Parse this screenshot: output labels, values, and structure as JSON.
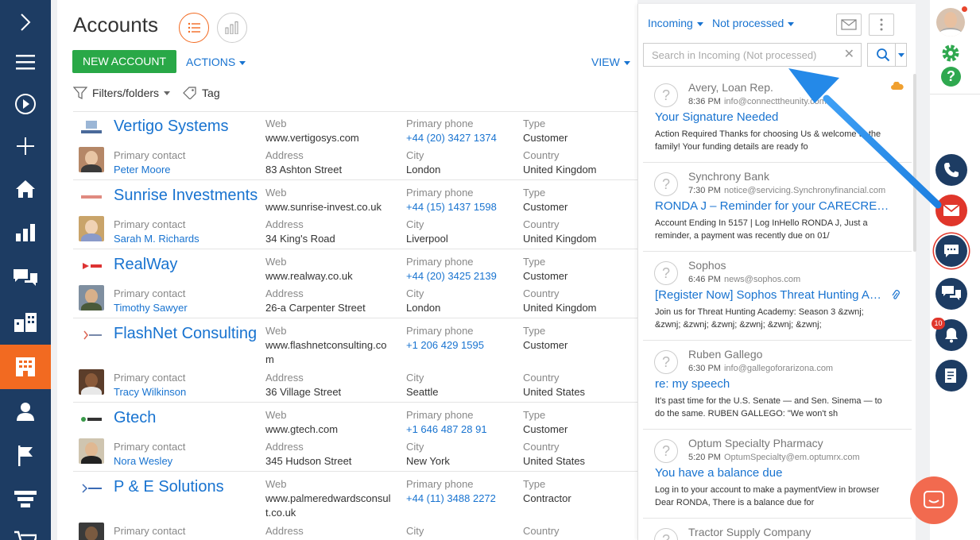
{
  "page": {
    "title": "Accounts",
    "new_account_label": "NEW ACCOUNT",
    "actions_label": "ACTIONS",
    "view_label": "VIEW",
    "filters_label": "Filters/folders",
    "tag_label": "Tag"
  },
  "nav": {
    "items": [
      "chevron-right-icon",
      "menu-icon",
      "play-icon",
      "plus-icon",
      "home-icon",
      "chart-icon",
      "chat-icon",
      "buildings-icon",
      "accounts-icon",
      "contact-icon",
      "flag-icon",
      "funnel-icon",
      "cart-icon"
    ],
    "active": "accounts-icon"
  },
  "labels": {
    "web": "Web",
    "primary_phone": "Primary phone",
    "type": "Type",
    "primary_contact": "Primary contact",
    "address": "Address",
    "city": "City",
    "country": "Country"
  },
  "accounts": [
    {
      "name": "Vertigo Systems",
      "web": "www.vertigosys.com",
      "phone": "+44 (20) 3427 1374",
      "type": "Customer",
      "contact": "Peter Moore",
      "address": "83 Ashton Street",
      "city": "London",
      "country": "United Kingdom"
    },
    {
      "name": "Sunrise Investments",
      "web": "www.sunrise-invest.co.uk",
      "phone": "+44 (15) 1437 1598",
      "type": "Customer",
      "contact": "Sarah M. Richards",
      "address": "34 King's Road",
      "city": "Liverpool",
      "country": "United Kingdom"
    },
    {
      "name": "RealWay",
      "web": "www.realway.co.uk",
      "phone": "+44 (20) 3425 2139",
      "type": "Customer",
      "contact": "Timothy Sawyer",
      "address": "26-a Carpenter Street",
      "city": "London",
      "country": "United Kingdom"
    },
    {
      "name": "FlashNet Consulting",
      "web": "www.flashnetconsulting.com",
      "phone": "+1 206 429 1595",
      "type": "Customer",
      "contact": "Tracy Wilkinson",
      "address": "36 Village Street",
      "city": "Seattle",
      "country": "United States"
    },
    {
      "name": "Gtech",
      "web": "www.gtech.com",
      "phone": "+1 646 487 28 91",
      "type": "Customer",
      "contact": "Nora Wesley",
      "address": "345 Hudson Street",
      "city": "New York",
      "country": "United States"
    },
    {
      "name": "P & E Solutions",
      "web": "www.palmeredwardsconsult.co.uk",
      "phone": "+44 (11) 3488 2272",
      "type": "Contractor",
      "contact": "",
      "address": "",
      "city": "",
      "country": ""
    }
  ],
  "feed": {
    "folder_label": "Incoming",
    "status_label": "Not processed",
    "search_placeholder": "Search in Incoming (Not processed)",
    "emails": [
      {
        "sender": "Avery, Loan Rep.",
        "time": "8:36 PM",
        "from": "info@connecttheunity.com",
        "subject": "Your Signature Needed",
        "preview": "Action Required Thanks for choosing Us & welcome to the family! Your funding details are ready fo"
      },
      {
        "sender": "Synchrony Bank",
        "time": "7:30 PM",
        "from": "notice@servicing.Synchronyfinancial.com",
        "subject": "RONDA J – Reminder for your CARECREDIT/S...",
        "preview": "Account Ending In 5157 | Log InHello RONDA J, Just a reminder, a payment was recently due on 01/"
      },
      {
        "sender": "Sophos",
        "time": "6:46 PM",
        "from": "news@sophos.com",
        "subject": "[Register Now] Sophos Threat Hunting Acad...",
        "preview": "Join us for Threat Hunting Academy: Season 3 &zwnj; &zwnj; &zwnj; &zwnj; &zwnj; &zwnj; &zwnj;"
      },
      {
        "sender": "Ruben Gallego",
        "time": "6:30 PM",
        "from": "info@gallegoforarizona.com",
        "subject": "re: my speech",
        "preview": "It's past time for the U.S. Senate — and Sen. Sinema — to do the same. RUBEN GALLEGO: \"We won't sh"
      },
      {
        "sender": "Optum Specialty Pharmacy",
        "time": "5:20 PM",
        "from": "OptumSpecialty@em.optumrx.com",
        "subject": "You have a balance due",
        "preview": "Log in to your account to make a paymentView in browser Dear RONDA, There is a balance due for"
      },
      {
        "sender": "Tractor Supply Company",
        "time": "",
        "from": "",
        "subject": "",
        "preview": ""
      }
    ]
  },
  "right_bar": {
    "notification_count": "10"
  },
  "colors": {
    "nav_bg": "#1d3c63",
    "accent": "#f26a21",
    "link": "#1873d0",
    "new_button": "#29a847",
    "email_red": "#e0362b"
  }
}
